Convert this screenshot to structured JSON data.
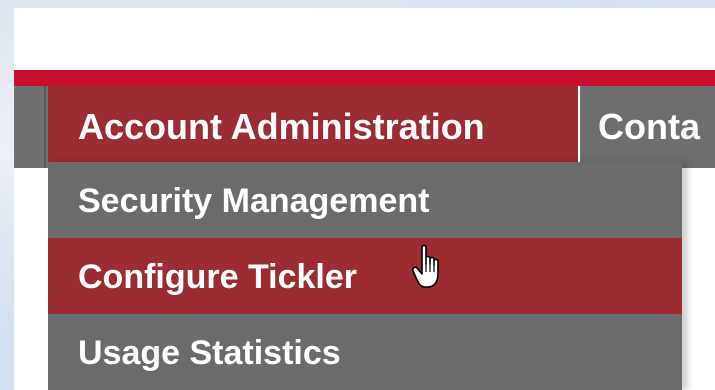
{
  "nav": {
    "items": [
      {
        "label": "Account Administration",
        "active": true
      },
      {
        "label": "Conta",
        "active": false
      }
    ]
  },
  "dropdown": {
    "items": [
      {
        "label": "Security Management",
        "hovered": false
      },
      {
        "label": "Configure Tickler",
        "hovered": true
      },
      {
        "label": "Usage Statistics",
        "hovered": false
      }
    ]
  },
  "colors": {
    "brand_red": "#c8102e",
    "active_red": "#9b2c31",
    "nav_gray": "#707070",
    "menu_gray": "#6b6b6b",
    "text": "#ffffff"
  },
  "icons": {
    "cursor": "hand-pointer-icon"
  }
}
